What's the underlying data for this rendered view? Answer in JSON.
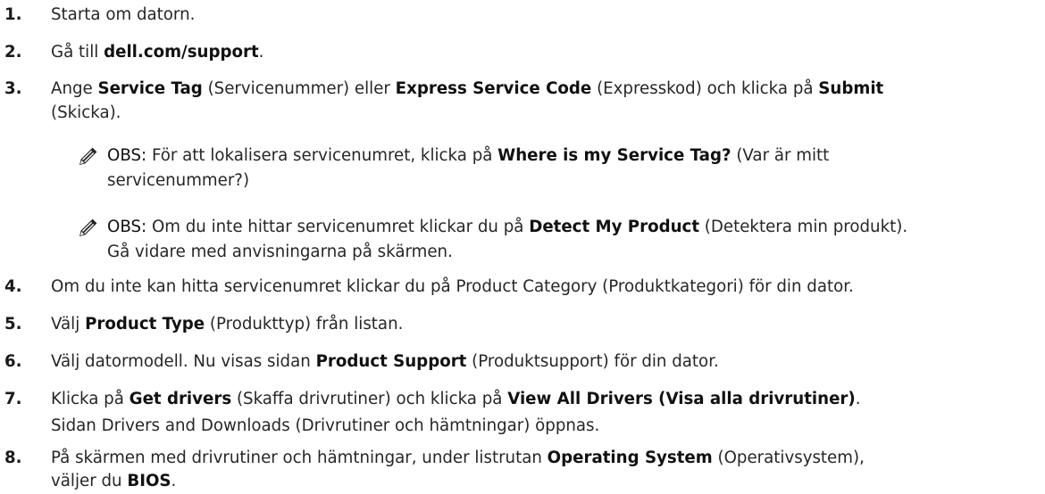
{
  "steps": [
    {
      "num": "1.",
      "parts": [
        {
          "t": "Starta om datorn.",
          "b": false
        }
      ]
    },
    {
      "num": "2.",
      "parts": [
        {
          "t": "Gå till ",
          "b": false
        },
        {
          "t": "dell.com/support",
          "b": true
        },
        {
          "t": ".",
          "b": false
        }
      ]
    },
    {
      "num": "3.",
      "parts": [
        {
          "t": "Ange ",
          "b": false
        },
        {
          "t": "Service Tag",
          "b": true
        },
        {
          "t": " (Servicenummer) eller ",
          "b": false
        },
        {
          "t": "Express Service Code",
          "b": true
        },
        {
          "t": " (Expresskod) och klicka på ",
          "b": false
        },
        {
          "t": "Submit",
          "b": true
        }
      ],
      "cont": "(Skicka)."
    },
    {
      "num": "4.",
      "parts": [
        {
          "t": "Om du inte kan hitta servicenumret klickar du på Product Category (Produktkategori) för din dator.",
          "b": false
        }
      ]
    },
    {
      "num": "5.",
      "parts": [
        {
          "t": "Välj ",
          "b": false
        },
        {
          "t": "Product Type",
          "b": true
        },
        {
          "t": " (Produkttyp) från listan.",
          "b": false
        }
      ]
    },
    {
      "num": "6.",
      "parts": [
        {
          "t": "Välj datormodell. Nu visas sidan ",
          "b": false
        },
        {
          "t": "Product Support",
          "b": true
        },
        {
          "t": " (Produktsupport) för din dator.",
          "b": false
        }
      ]
    },
    {
      "num": "7.",
      "parts": [
        {
          "t": "Klicka på ",
          "b": false
        },
        {
          "t": "Get drivers",
          "b": true
        },
        {
          "t": " (Skaffa drivrutiner) och klicka på ",
          "b": false
        },
        {
          "t": "View All Drivers (Visa alla drivrutiner)",
          "b": true
        },
        {
          "t": ".",
          "b": false
        }
      ],
      "cont": "Sidan Drivers and Downloads (Drivrutiner och hämtningar) öppnas."
    },
    {
      "num": "8.",
      "parts": [
        {
          "t": "På skärmen med drivrutiner och hämtningar, under listrutan ",
          "b": false
        },
        {
          "t": "Operating System",
          "b": true
        },
        {
          "t": " (Operativsystem),",
          "b": false
        }
      ],
      "cont_parts": [
        {
          "t": "väljer du ",
          "b": false
        },
        {
          "t": "BIOS",
          "b": true
        },
        {
          "t": ".",
          "b": false
        }
      ]
    }
  ],
  "notes": [
    {
      "label": "OBS:",
      "parts": [
        {
          "t": " För att lokalisera servicenumret, klicka på ",
          "b": false
        },
        {
          "t": "Where is my Service Tag?",
          "b": true
        },
        {
          "t": " (Var är mitt",
          "b": false
        }
      ],
      "cont": "servicenummer?)"
    },
    {
      "label": "OBS:",
      "parts": [
        {
          "t": " Om du inte hittar servicenumret klickar du på ",
          "b": false
        },
        {
          "t": "Detect My Product",
          "b": true
        },
        {
          "t": " (Detektera min produkt).",
          "b": false
        }
      ],
      "cont": "Gå vidare med anvisningarna på skärmen."
    }
  ],
  "icon": "note-pencil-icon"
}
